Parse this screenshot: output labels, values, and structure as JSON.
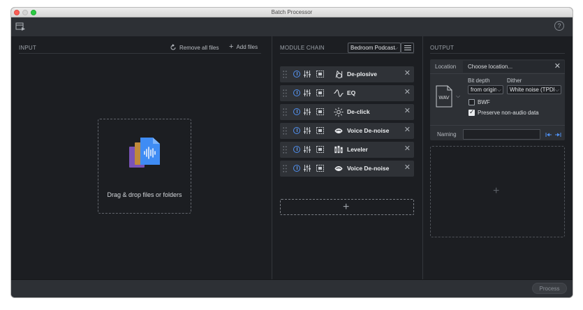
{
  "window": {
    "title": "Batch Processor"
  },
  "toolbar": {
    "icon": "batch-list-icon",
    "help_icon": "help-icon",
    "help_glyph": "?"
  },
  "input": {
    "title": "INPUT",
    "remove_all_label": "Remove all files",
    "add_files_label": "Add files",
    "drop_text": "Drag & drop files or folders"
  },
  "module_chain": {
    "title": "MODULE CHAIN",
    "preset": "Bedroom Podcast",
    "modules": [
      {
        "label": "De-plosive",
        "icon": "deplosive-icon"
      },
      {
        "label": "EQ",
        "icon": "eq-icon"
      },
      {
        "label": "De-click",
        "icon": "declick-icon"
      },
      {
        "label": "Voice De-noise",
        "icon": "voice-denoise-icon"
      },
      {
        "label": "Leveler",
        "icon": "leveler-icon"
      },
      {
        "label": "Voice De-noise",
        "icon": "voice-denoise-icon"
      }
    ]
  },
  "output": {
    "title": "OUTPUT",
    "location_label": "Location",
    "location_value": "Choose location...",
    "format": "WAV",
    "bit_depth_label": "Bit depth",
    "bit_depth_value": "from original",
    "dither_label": "Dither",
    "dither_value": "White noise (TPDF)",
    "bwf_label": "BWF",
    "bwf_checked": false,
    "preserve_label": "Preserve non-audio data",
    "preserve_checked": true,
    "naming_label": "Naming",
    "naming_value": ""
  },
  "footer": {
    "process_label": "Process"
  },
  "colors": {
    "accent": "#4f8ff0",
    "background": "#1c1e22",
    "panel": "#2f3237"
  }
}
